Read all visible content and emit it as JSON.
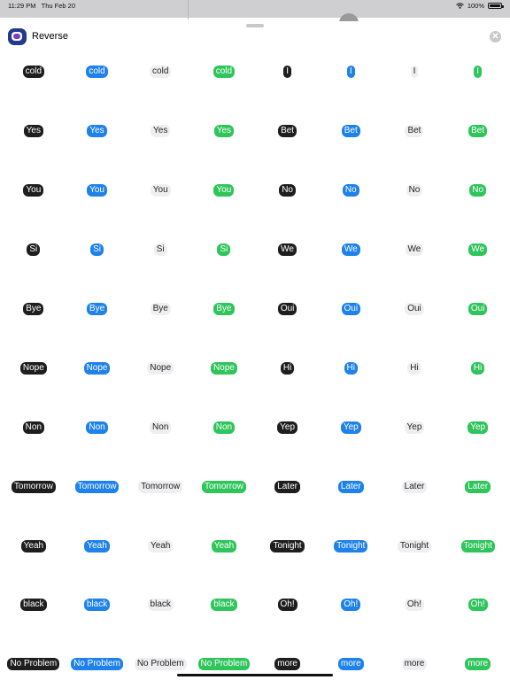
{
  "status_bar": {
    "time": "11:29 PM",
    "date": "Thu Feb 20",
    "battery": "100%",
    "icons": [
      "wifi-icon",
      "battery-icon"
    ]
  },
  "header": {
    "app_name": "Reverse",
    "app_icon": "reverse-app-icon",
    "close_icon": "close-icon",
    "close_glyph": "✕"
  },
  "colors": {
    "dark": "#1e1e1e",
    "blue": "#1e82ea",
    "light": "#efeff1",
    "green": "#2fc55b"
  },
  "style_order": [
    "dark",
    "blue",
    "light",
    "green",
    "dark",
    "blue",
    "light",
    "green"
  ],
  "stickers": [
    [
      "cold",
      "cold",
      "cold",
      "cold",
      "I",
      "I",
      "I",
      "I"
    ],
    [
      "Yes",
      "Yes",
      "Yes",
      "Yes",
      "Bet",
      "Bet",
      "Bet",
      "Bet"
    ],
    [
      "You",
      "You",
      "You",
      "You",
      "No",
      "No",
      "No",
      "No"
    ],
    [
      "Si",
      "Si",
      "Si",
      "Si",
      "We",
      "We",
      "We",
      "We"
    ],
    [
      "Bye",
      "Bye",
      "Bye",
      "Bye",
      "Oui",
      "Oui",
      "Oui",
      "Oui"
    ],
    [
      "Nope",
      "Nope",
      "Nope",
      "Nope",
      "Hi",
      "Hi",
      "Hi",
      "Hi"
    ],
    [
      "Non",
      "Non",
      "Non",
      "Non",
      "Yep",
      "Yep",
      "Yep",
      "Yep"
    ],
    [
      "Tomorrow",
      "Tomorrow",
      "Tomorrow",
      "Tomorrow",
      "Later",
      "Later",
      "Later",
      "Later"
    ],
    [
      "Yeah",
      "Yeah",
      "Yeah",
      "Yeah",
      "Tonight",
      "Tonight",
      "Tonight",
      "Tonight"
    ],
    [
      "black",
      "black",
      "black",
      "black",
      "Oh!",
      "Oh!",
      "Oh!",
      "Oh!"
    ],
    [
      "No Problem",
      "No Problem",
      "No Problem",
      "No Problem",
      "more",
      "more",
      "more",
      "more"
    ]
  ]
}
